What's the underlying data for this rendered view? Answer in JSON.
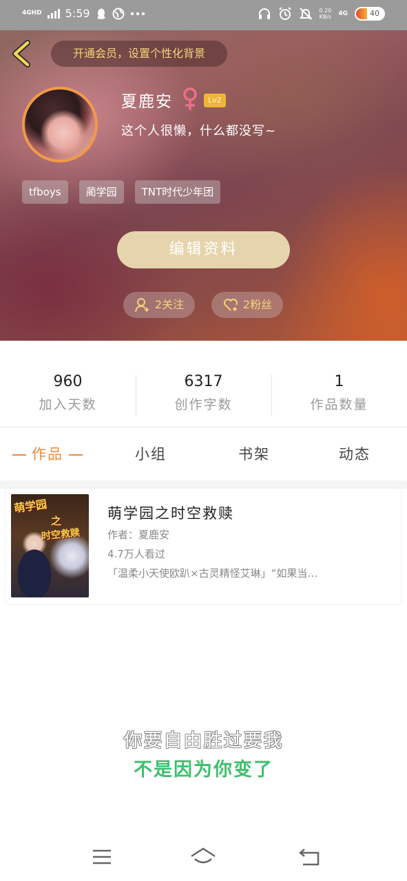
{
  "status_bar": {
    "network": "4GHD",
    "time": "5:59",
    "speed_value": "0.20",
    "speed_unit": "KB/s",
    "mobile": "4G",
    "battery": "40",
    "battery_level": 0.4
  },
  "header": {
    "vip_banner": "开通会员，设置个性化背景",
    "username": "夏鹿安",
    "gender_symbol": "♀",
    "level_badge": "Lv2",
    "bio": "这个人很懒，什么都没写~",
    "tags": [
      "tfboys",
      "蔺学园",
      "TNT时代少年团"
    ],
    "edit_button": "编辑资料",
    "following_label": "2关注",
    "fans_label": "2粉丝",
    "accent_color": "#f6d37a"
  },
  "stats": [
    {
      "value": "960",
      "label": "加入天数"
    },
    {
      "value": "6317",
      "label": "创作字数"
    },
    {
      "value": "1",
      "label": "作品数量"
    }
  ],
  "tabs": [
    {
      "label": "作品",
      "active": true
    },
    {
      "label": "小组",
      "active": false
    },
    {
      "label": "书架",
      "active": false
    },
    {
      "label": "动态",
      "active": false
    }
  ],
  "works": [
    {
      "cover_title_line1": "萌学园",
      "cover_title_line2": "之",
      "cover_title_line3": "时空救赎",
      "title": "萌学园之时空救赎",
      "author": "作者：夏鹿安",
      "views": "4.7万人看过",
      "description": "「温柔小天使欧趴×古灵精怪艾琳」“如果当…"
    }
  ],
  "lyrics": {
    "line1": "你要自由胜过要我",
    "line2": "不是因为你变了"
  },
  "colors": {
    "active_tab": "#f08a3a",
    "lyric_highlight": "#3fbf6f",
    "edit_button_bg": "#e6d4ad"
  }
}
